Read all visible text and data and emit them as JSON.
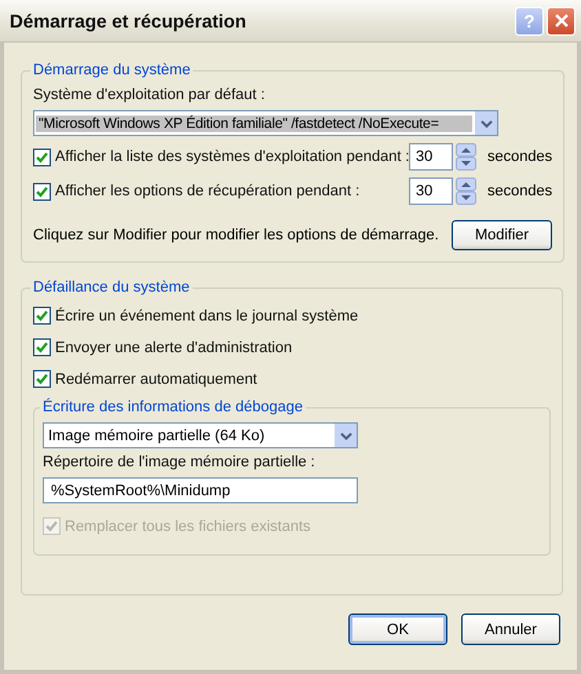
{
  "window": {
    "title": "Démarrage et récupération",
    "help": "?"
  },
  "startup": {
    "legend": "Démarrage du système",
    "default_os_label": "Système d'exploitation par défaut :",
    "default_os": "\"Microsoft Windows XP Édition familiale\" /fastdetect /NoExecute=",
    "timeouts": [
      {
        "label": "Afficher la liste des systèmes d'exploitation pendant :",
        "checked": true,
        "value": "30",
        "unit": "secondes"
      },
      {
        "label": "Afficher les options de récupération pendant :",
        "checked": true,
        "value": "30",
        "unit": "secondes"
      }
    ],
    "hint": "Cliquez sur Modifier pour modifier les options de démarrage.",
    "modify_button": "Modifier"
  },
  "failure": {
    "legend": "Défaillance du système",
    "options": [
      {
        "label": "Écrire un événement dans le journal système",
        "checked": true
      },
      {
        "label": "Envoyer une alerte d'administration",
        "checked": true
      },
      {
        "label": "Redémarrer automatiquement",
        "checked": true
      }
    ],
    "debug": {
      "legend": "Écriture des informations de débogage",
      "dump_type": "Image mémoire partielle (64 Ko)",
      "dir_label": "Répertoire de l'image mémoire partielle :",
      "dir_value": "%SystemRoot%\\Minidump",
      "overwrite": {
        "label": "Remplacer tous les fichiers existants",
        "checked": true,
        "disabled": true
      }
    }
  },
  "buttons": [
    "OK",
    "Annuler"
  ]
}
